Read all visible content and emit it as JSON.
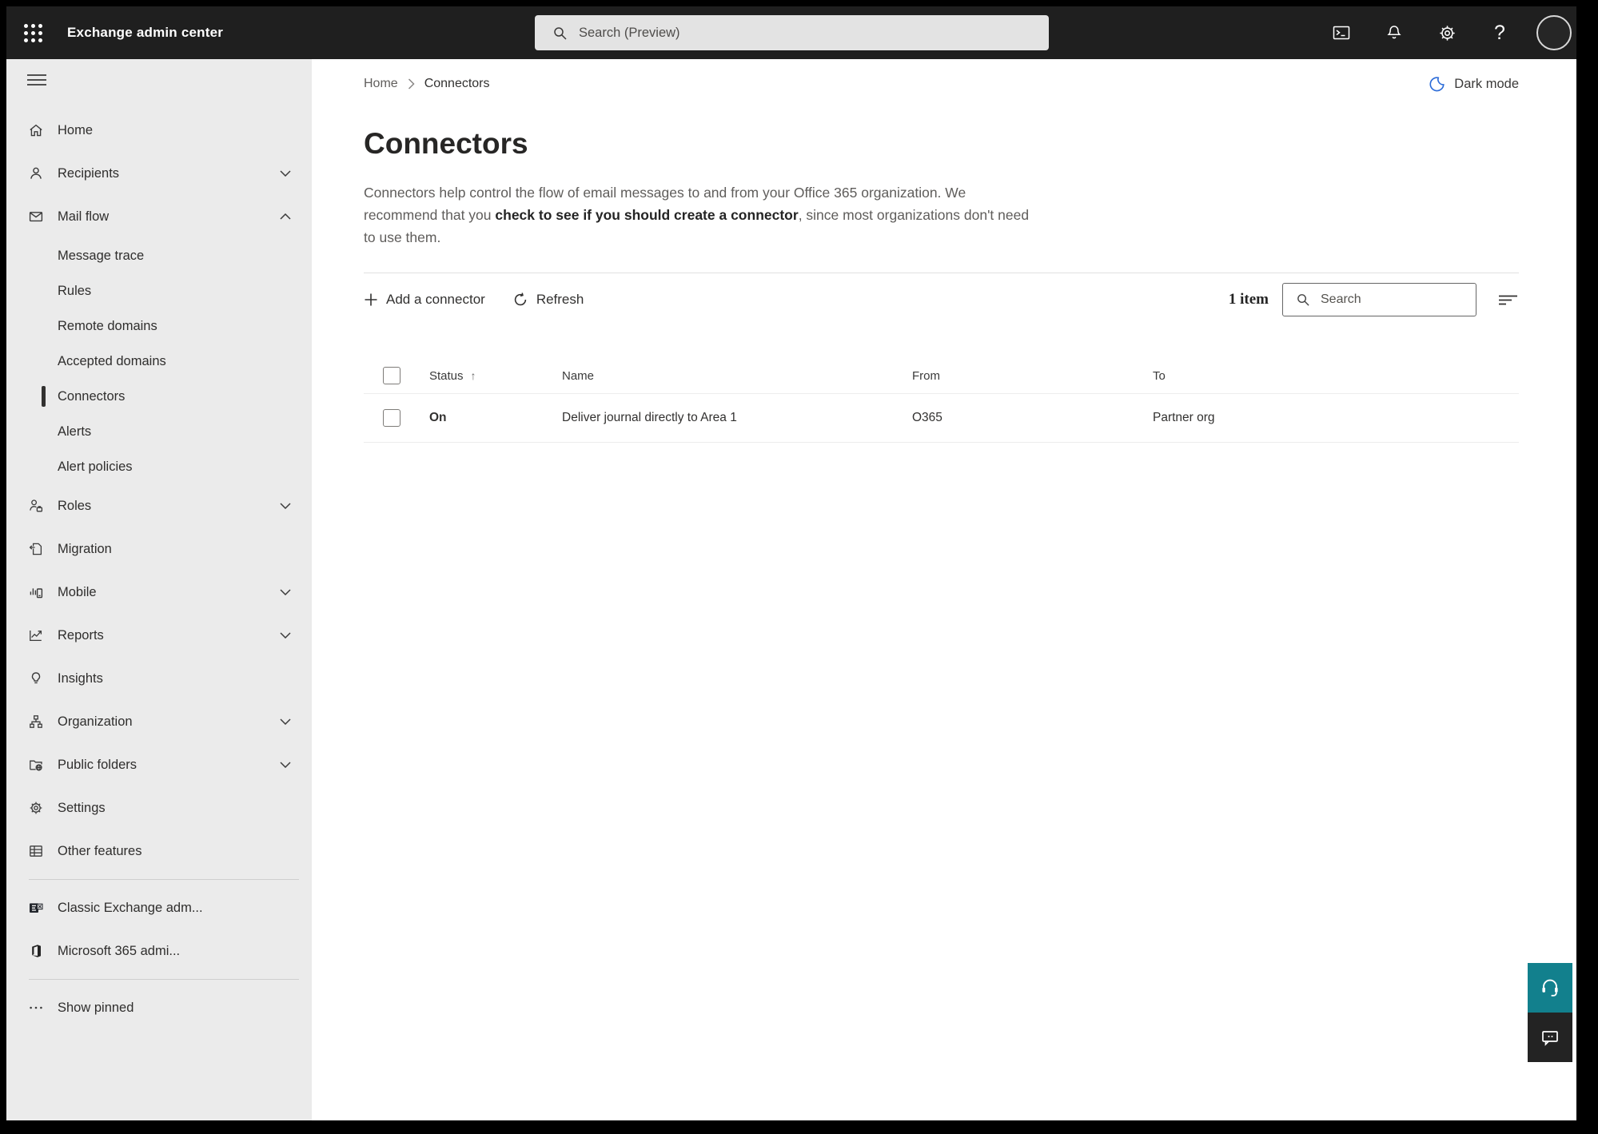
{
  "colors": {
    "topbar_bg": "#1f1f1f",
    "sidebar_bg": "#ebebeb",
    "accent_blue": "#2b6bd8",
    "support_teal": "#12808d",
    "feedback_dark": "#232323"
  },
  "topbar": {
    "title": "Exchange admin center",
    "search_placeholder": "Search (Preview)"
  },
  "sidebar": {
    "items": [
      {
        "label": "Home"
      },
      {
        "label": "Recipients"
      },
      {
        "label": "Mail flow"
      },
      {
        "label": "Message trace"
      },
      {
        "label": "Rules"
      },
      {
        "label": "Remote domains"
      },
      {
        "label": "Accepted domains"
      },
      {
        "label": "Connectors"
      },
      {
        "label": "Alerts"
      },
      {
        "label": "Alert policies"
      },
      {
        "label": "Roles"
      },
      {
        "label": "Migration"
      },
      {
        "label": "Mobile"
      },
      {
        "label": "Reports"
      },
      {
        "label": "Insights"
      },
      {
        "label": "Organization"
      },
      {
        "label": "Public folders"
      },
      {
        "label": "Settings"
      },
      {
        "label": "Other features"
      },
      {
        "label": "Classic Exchange adm..."
      },
      {
        "label": "Microsoft 365 admi..."
      },
      {
        "label": "Show pinned"
      }
    ]
  },
  "breadcrumb": {
    "home": "Home",
    "current": "Connectors"
  },
  "dark_mode_label": "Dark mode",
  "page": {
    "title": "Connectors",
    "desc_pre": "Connectors help control the flow of email messages to and from your Office 365 organization. We recommend that you ",
    "desc_link": "check to see if you should create a connector",
    "desc_post": ", since most organizations don't need to use them."
  },
  "toolbar": {
    "add_label": "Add a connector",
    "refresh_label": "Refresh",
    "count_label": "1 item",
    "search_placeholder": "Search"
  },
  "table": {
    "headers": {
      "status": "Status",
      "name": "Name",
      "from": "From",
      "to": "To"
    },
    "sort_arrow": "↑",
    "rows": [
      {
        "status": "On",
        "name": "Deliver journal directly to Area 1",
        "from": "O365",
        "to": "Partner org"
      }
    ]
  }
}
